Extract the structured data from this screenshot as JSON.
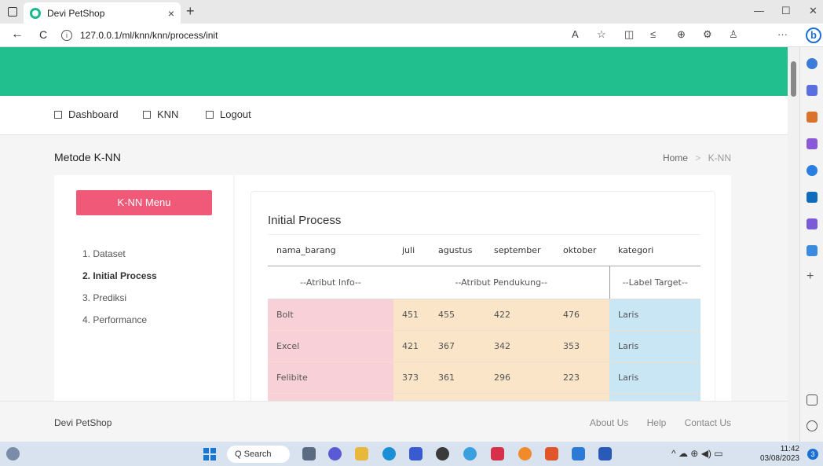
{
  "browser": {
    "tab_title": "Devi PetShop",
    "tab_close": "×",
    "new_tab": "+",
    "url": "127.0.0.1/ml/knn/knn/process/init",
    "back": "←",
    "reload": "C",
    "info": "i",
    "toolbar_more": "···",
    "bing_label": "b",
    "win_min": "—",
    "win_max": "☐",
    "win_close": "✕"
  },
  "nav": {
    "items": [
      {
        "label": "Dashboard",
        "icon": "grid-icon"
      },
      {
        "label": "KNN",
        "icon": "list-icon"
      },
      {
        "label": "Logout",
        "icon": "list-icon"
      }
    ]
  },
  "page": {
    "title": "Metode K-NN",
    "breadcrumb_home": "Home",
    "breadcrumb_sep": ">",
    "breadcrumb_current": "K-NN"
  },
  "sidebar_menu": {
    "button": "K-NN Menu",
    "items": [
      "1. Dataset",
      "2. Initial Process",
      "3. Prediksi",
      "4. Performance"
    ],
    "active_index": 1
  },
  "content": {
    "section_title": "Initial Process",
    "columns": [
      "nama_barang",
      "juli",
      "agustus",
      "september",
      "oktober",
      "kategori"
    ],
    "groups": {
      "info": "--Atribut Info--",
      "support": "--Atribut Pendukung--",
      "target": "--Label Target--"
    },
    "rows": [
      [
        "Bolt",
        "451",
        "455",
        "422",
        "476",
        "Laris"
      ],
      [
        "Excel",
        "421",
        "367",
        "342",
        "353",
        "Laris"
      ],
      [
        "Felibite",
        "373",
        "361",
        "296",
        "223",
        "Laris"
      ]
    ]
  },
  "footer": {
    "brand": "Devi PetShop",
    "links": [
      "About Us",
      "Help",
      "Contact Us"
    ]
  },
  "taskbar": {
    "search": "Q Search",
    "time": "11:42",
    "date": "03/08/2023",
    "notifications": "3",
    "tray_icons": "^ ☁ ⊕ ◀) ▭"
  },
  "colors": {
    "header_green": "#22bf8e",
    "menu_button": "#f05a78",
    "info_cell": "#f8d0d8",
    "support_cell": "#fae5c8",
    "target_cell": "#c8e6f4"
  }
}
